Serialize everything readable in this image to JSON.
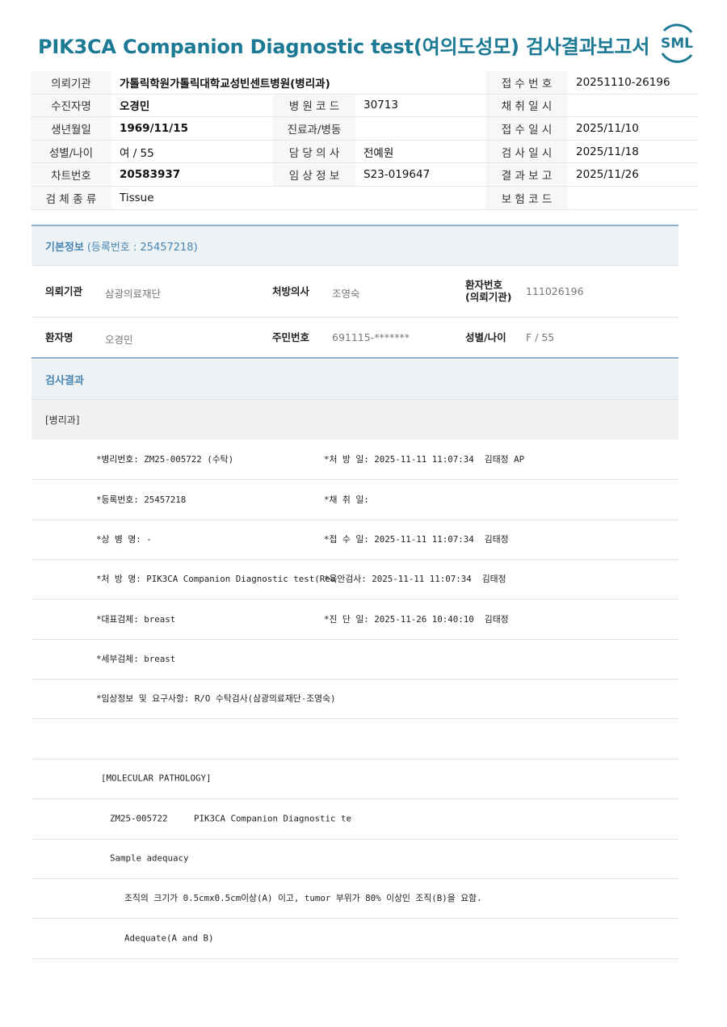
{
  "title": "PIK3CA Companion Diagnostic test(여의도성모) 검사결과보고서",
  "logo_text": "SML",
  "accent_color": "#1d7a94",
  "header_table": [
    [
      {
        "l": "의뢰기관",
        "v": "가톨릭학원가톨릭대학교성빈센트병원(병리과)",
        "span": true
      },
      {
        "l": "접 수 번 호",
        "v": "20251110-26196"
      }
    ],
    [
      {
        "l": "수진자명",
        "v": "오경민"
      },
      {
        "l": "병 원 코 드",
        "v": "30713"
      },
      {
        "l": "채 취 일 시",
        "v": ""
      }
    ],
    [
      {
        "l": "생년월일",
        "v": "1969/11/15"
      },
      {
        "l": "진료과/병동",
        "v": ""
      },
      {
        "l": "접 수 일 시",
        "v": "2025/11/10"
      }
    ],
    [
      {
        "l": "성별/나이",
        "v": "여 / 55"
      },
      {
        "l": "담 당 의 사",
        "v": "전예원"
      },
      {
        "l": "검 사 일 시",
        "v": "2025/11/18"
      }
    ],
    [
      {
        "l": "차트번호",
        "v": "20583937"
      },
      {
        "l": "임 상 정 보",
        "v": "S23-019647"
      },
      {
        "l": "결 과 보 고",
        "v": "2025/11/26"
      }
    ],
    [
      {
        "l": "검 체 종 류",
        "v": "Tissue",
        "span": true
      },
      {
        "l": "보 험 코 드",
        "v": ""
      }
    ]
  ],
  "basic": {
    "heading": "기본정보",
    "reg": "(등록번호 : 25457218)",
    "req_org_label": "의뢰기관",
    "req_org": "삼광의료재단",
    "doctor_label": "처방의사",
    "doctor": "조영숙",
    "pt_no_label1": "환자번호",
    "pt_no_label2": "(의뢰기관)",
    "pt_no": "111026196",
    "pt_name_label": "환자명",
    "pt_name": "오경민",
    "rrn_label": "주민번호",
    "rrn": "691115-*******",
    "sex_label": "성별/나이",
    "sex": "F / 55"
  },
  "result": {
    "heading": "검사결과",
    "dept": "[병리과]",
    "rows": [
      {
        "a": "*병리번호: ZM25-005722 (수탁)",
        "b": "*처 방 일: 2025-11-11 11:07:34  김태정 AP"
      },
      {
        "a": "*등록번호: 25457218",
        "b": "*채 취 일:"
      },
      {
        "a": "*상 병 명: -",
        "b": "*접 수 일: 2025-11-11 11:07:34  김태정"
      },
      {
        "a": "*처 방 명: PIK3CA Companion Diagnostic test(Rea",
        "b": "*육안검사: 2025-11-11 11:07:34  김태정"
      },
      {
        "a": "*대표검체: breast",
        "b": "*진 단 일: 2025-11-26 10:40:10  김태정"
      },
      {
        "a": "*세부검체: breast",
        "b": ""
      },
      {
        "a": "*임상정보 및 요구사항: R/O 수탁검사(삼광의료재단-조영숙)",
        "b": ""
      },
      {
        "a": "",
        "b": ""
      }
    ],
    "mol": [
      "[MOLECULAR PATHOLOGY]",
      "ZM25-005722     PIK3CA Companion Diagnostic te",
      "Sample adequacy",
      "조직의 크기가 0.5cmx0.5cm이상(A) 이고, tumor 부위가 80% 이상인 조직(B)을 요함.",
      "Adequate(A and B)"
    ]
  }
}
